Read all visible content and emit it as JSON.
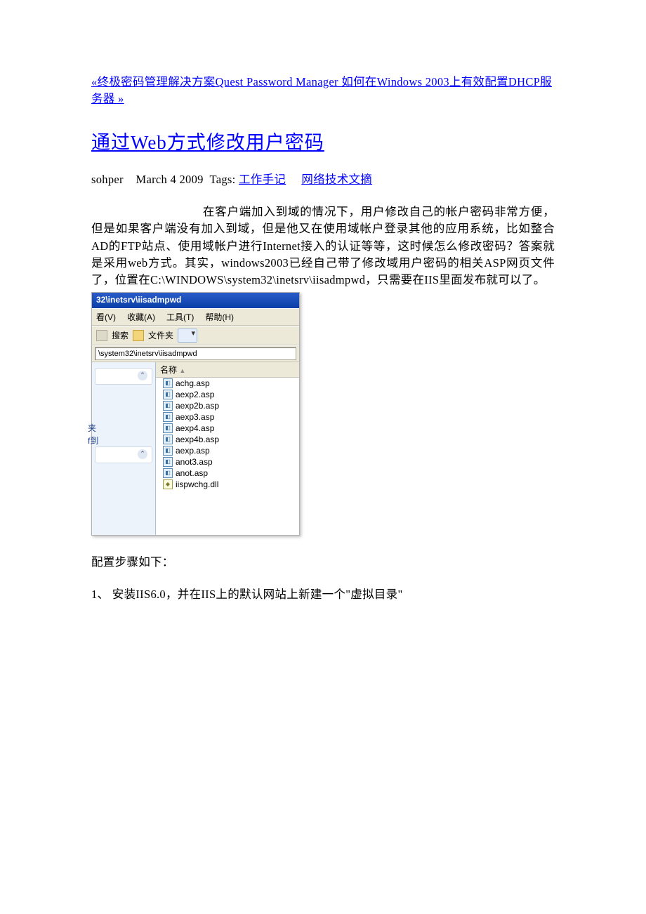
{
  "nav": {
    "prev": "«终极密码管理解决方案Quest Password Manager 如何在Windows 2003上有效配置DHCP服务器 »"
  },
  "title": "通过Web方式修改用户密码",
  "meta": {
    "author": "sohper",
    "date": "March 4 2009",
    "tags_label": "Tags:",
    "tag1": "工作手记",
    "tag2": "网络技术文摘"
  },
  "para1": "在客户端加入到域的情况下，用户修改自己的帐户密码非常方便，但是如果客户端没有加入到域，但是他又在使用域帐户登录其他的应用系统，比如整合AD的FTP站点、使用域帐户进行Internet接入的认证等等，这时候怎么修改密码？答案就是采用web方式。其实，windows2003已经自己带了修改域用户密码的相关ASP网页文件了，位置在C:\\WINDOWS\\system32\\inetsrv\\iisadmpwd，只需要在IIS里面发布就可以了。",
  "explorer": {
    "title": "32\\inetsrv\\iisadmpwd",
    "menu": {
      "view": "看(V)",
      "fav": "收藏(A)",
      "tools": "工具(T)",
      "help": "帮助(H)"
    },
    "toolbar": {
      "search": "搜索",
      "folders": "文件夹"
    },
    "address": "\\system32\\inetsrv\\iisadmpwd",
    "side": {
      "label1": "夹",
      "label2": "f到"
    },
    "list_header": "名称",
    "files": [
      {
        "name": "achg.asp",
        "type": "asp"
      },
      {
        "name": "aexp2.asp",
        "type": "asp"
      },
      {
        "name": "aexp2b.asp",
        "type": "asp"
      },
      {
        "name": "aexp3.asp",
        "type": "asp"
      },
      {
        "name": "aexp4.asp",
        "type": "asp"
      },
      {
        "name": "aexp4b.asp",
        "type": "asp"
      },
      {
        "name": "aexp.asp",
        "type": "asp"
      },
      {
        "name": "anot3.asp",
        "type": "asp"
      },
      {
        "name": "anot.asp",
        "type": "asp"
      },
      {
        "name": "iispwchg.dll",
        "type": "dll"
      }
    ]
  },
  "steps_intro": "配置步骤如下：",
  "step1": "1、 安装IIS6.0，并在IIS上的默认网站上新建一个\"虚拟目录\""
}
